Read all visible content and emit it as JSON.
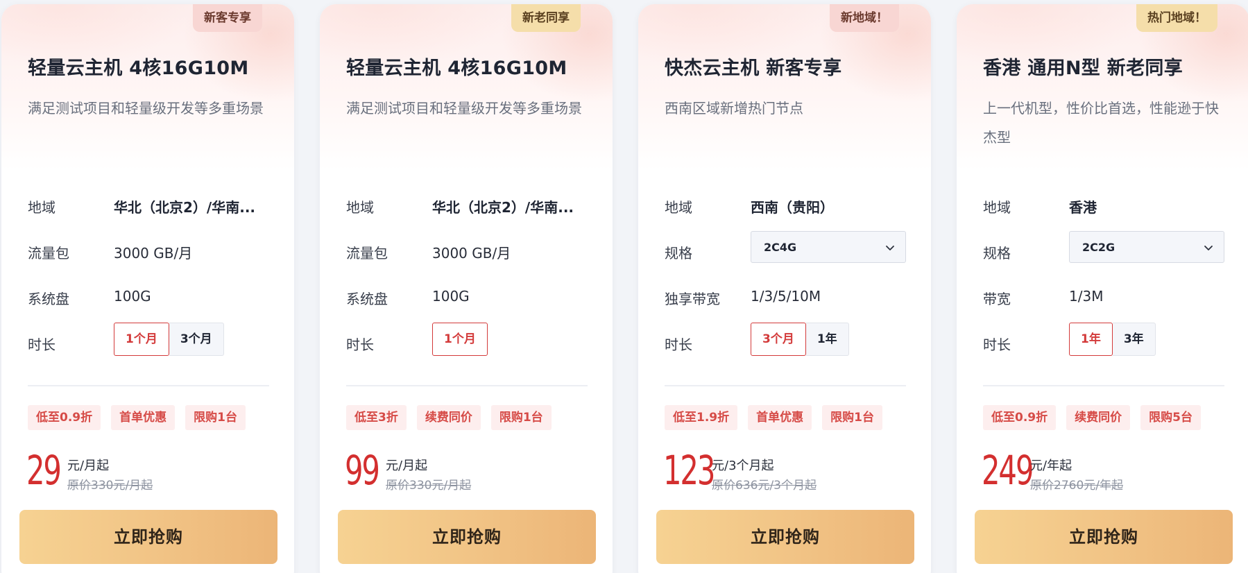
{
  "cards": [
    {
      "badge": "新客专享",
      "title": "轻量云主机 4核16G10M",
      "desc": "满足测试项目和轻量级开发等多重场景",
      "specs": [
        {
          "label": "地域",
          "value": "华北（北京2）/华南..."
        },
        {
          "label": "流量包",
          "value": "3000 GB/月"
        },
        {
          "label": "系统盘",
          "value": "100G"
        }
      ],
      "duration_label": "时长",
      "durations": [
        "1个月",
        "3个月"
      ],
      "selected_duration": "1个月",
      "tags": [
        "低至0.9折",
        "首单优惠",
        "限购1台"
      ],
      "price": "29",
      "price_unit": "元/月起",
      "original_price": "原价330元/月起",
      "buy_label": "立即抢购"
    },
    {
      "badge": "新老同享",
      "title": "轻量云主机 4核16G10M",
      "desc": "满足测试项目和轻量级开发等多重场景",
      "specs": [
        {
          "label": "地域",
          "value": "华北（北京2）/华南..."
        },
        {
          "label": "流量包",
          "value": "3000 GB/月"
        },
        {
          "label": "系统盘",
          "value": "100G"
        }
      ],
      "duration_label": "时长",
      "durations": [
        "1个月"
      ],
      "selected_duration": "1个月",
      "tags": [
        "低至3折",
        "续费同价",
        "限购1台"
      ],
      "price": "99",
      "price_unit": "元/月起",
      "original_price": "原价330元/月起",
      "buy_label": "立即抢购"
    },
    {
      "badge": "新地域！",
      "title": "快杰云主机 新客专享",
      "desc": "西南区域新增热门节点",
      "specs": [
        {
          "label": "地域",
          "value": "西南（贵阳）"
        },
        {
          "label": "规格",
          "value": "2C4G"
        },
        {
          "label": "独享带宽",
          "value": "1/3/5/10M"
        }
      ],
      "duration_label": "时长",
      "durations": [
        "3个月",
        "1年"
      ],
      "selected_duration": "3个月",
      "tags": [
        "低至1.9折",
        "首单优惠",
        "限购1台"
      ],
      "price": "123",
      "price_unit": "元/3个月起",
      "original_price": "原价636元/3个月起",
      "buy_label": "立即抢购"
    },
    {
      "badge": "热门地域！",
      "title": "香港 通用N型 新老同享",
      "desc": "上一代机型，性价比首选，性能逊于快杰型",
      "specs": [
        {
          "label": "地域",
          "value": "香港"
        },
        {
          "label": "规格",
          "value": "2C2G"
        },
        {
          "label": "带宽",
          "value": "1/3M"
        }
      ],
      "duration_label": "时长",
      "durations": [
        "1年",
        "3年"
      ],
      "selected_duration": "1年",
      "tags": [
        "低至0.9折",
        "续费同价",
        "限购5台"
      ],
      "price": "249",
      "price_unit": "元/年起",
      "original_price": "原价2760元/年起",
      "buy_label": "立即抢购"
    }
  ]
}
